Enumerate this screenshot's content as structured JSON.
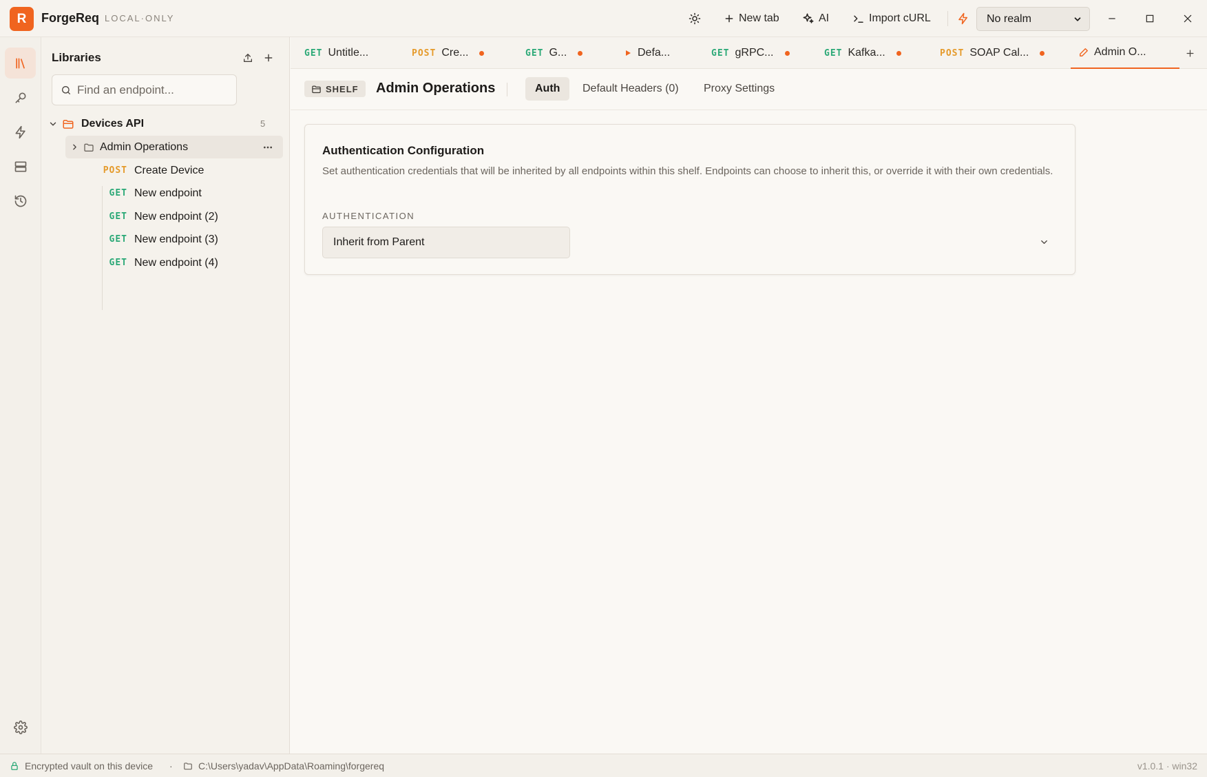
{
  "app": {
    "logo_letter": "R",
    "name": "ForgeReq",
    "mode": "LOCAL·ONLY"
  },
  "toolbar": {
    "new_tab_label": "New tab",
    "ai_label": "AI",
    "import_label": "Import cURL",
    "realm_value": "No realm"
  },
  "sidebar": {
    "title": "Libraries",
    "search_placeholder": "Find an endpoint...",
    "collection": {
      "name": "Devices API",
      "count": "5"
    },
    "folder": {
      "name": "Admin Operations"
    },
    "endpoints": [
      {
        "method": "POST",
        "name": "Create Device"
      },
      {
        "method": "GET",
        "name": "New endpoint"
      },
      {
        "method": "GET",
        "name": "New endpoint (2)"
      },
      {
        "method": "GET",
        "name": "New endpoint (3)"
      },
      {
        "method": "GET",
        "name": "New endpoint (4)"
      }
    ]
  },
  "tabs": [
    {
      "method": "GET",
      "label": "Untitle...",
      "dirty": false
    },
    {
      "method": "POST",
      "label": "Cre...",
      "dirty": true
    },
    {
      "method": "GET",
      "label": "G...",
      "dirty": true
    },
    {
      "method": "",
      "label": "Defa...",
      "dirty": false
    },
    {
      "method": "GET",
      "label": "gRPC...",
      "dirty": true
    },
    {
      "method": "GET",
      "label": "Kafka...",
      "dirty": true
    },
    {
      "method": "POST",
      "label": "SOAP Cal...",
      "dirty": true
    },
    {
      "method": "",
      "label": "Admin O...",
      "dirty": false
    }
  ],
  "shelf": {
    "badge": "SHELF",
    "name": "Admin Operations",
    "subtabs": [
      "Auth",
      "Default Headers (0)",
      "Proxy Settings"
    ]
  },
  "auth_card": {
    "title": "Authentication Configuration",
    "description": "Set authentication credentials that will be inherited by all endpoints within this shelf. Endpoints can choose to inherit this, or override it with their own credentials.",
    "field_label": "AUTHENTICATION",
    "value": "Inherit from Parent"
  },
  "status": {
    "vault": "Encrypted vault on this device",
    "separator": "·",
    "path": "C:\\Users\\yadav\\AppData\\Roaming\\forgereq",
    "version": "v1.0.1 · win32"
  },
  "colors": {
    "accent": "#f0641f",
    "get": "#2aa876",
    "post": "#e59a2a"
  }
}
